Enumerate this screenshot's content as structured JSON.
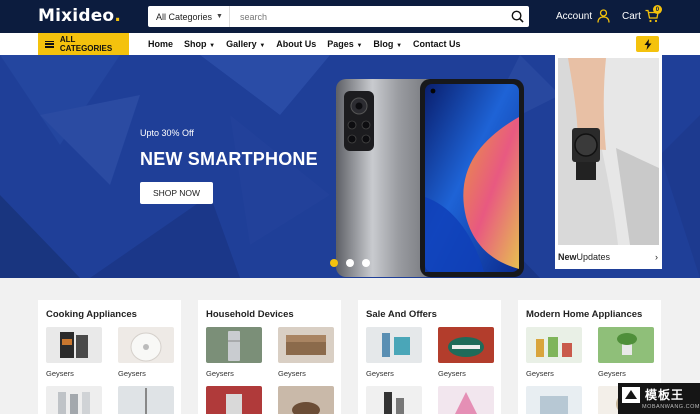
{
  "header": {
    "logo_text": "Mixideo",
    "logo_dot": ".",
    "search": {
      "category": "All Categories",
      "placeholder": "search"
    },
    "account_label": "Account",
    "cart_label": "Cart",
    "cart_count": "0"
  },
  "nav": {
    "all_categories": "ALL CATEGORIES",
    "links": [
      {
        "label": "Home",
        "has_caret": false
      },
      {
        "label": "Shop",
        "has_caret": true
      },
      {
        "label": "Gallery",
        "has_caret": true
      },
      {
        "label": "About Us",
        "has_caret": false
      },
      {
        "label": "Pages",
        "has_caret": true
      },
      {
        "label": "Blog",
        "has_caret": true
      },
      {
        "label": "Contact Us",
        "has_caret": false
      }
    ]
  },
  "hero": {
    "subtitle": "Upto 30% Off",
    "title": "NEW SMARTPHONE",
    "cta": "SHOP NOW",
    "slides_total": 3,
    "active_slide": 1
  },
  "side_card": {
    "label_bold": "New",
    "label_rest": "Updates",
    "arrow": "›"
  },
  "categories": [
    {
      "title": "Cooking Appliances",
      "items": [
        "Geysers",
        "Geysers"
      ]
    },
    {
      "title": "Household Devices",
      "items": [
        "Geysers",
        "Geysers"
      ]
    },
    {
      "title": "Sale And Offers",
      "items": [
        "Geysers",
        "Geysers"
      ]
    },
    {
      "title": "Modern Home Appliances",
      "items": [
        "Geysers",
        "Geysers"
      ]
    }
  ],
  "watermark": {
    "cn": "模板王",
    "en": "MOBANWANG.COM"
  },
  "colors": {
    "header_bg": "#0c1c3e",
    "accent": "#f4c20d",
    "hero_bg": "#1f3f98"
  }
}
